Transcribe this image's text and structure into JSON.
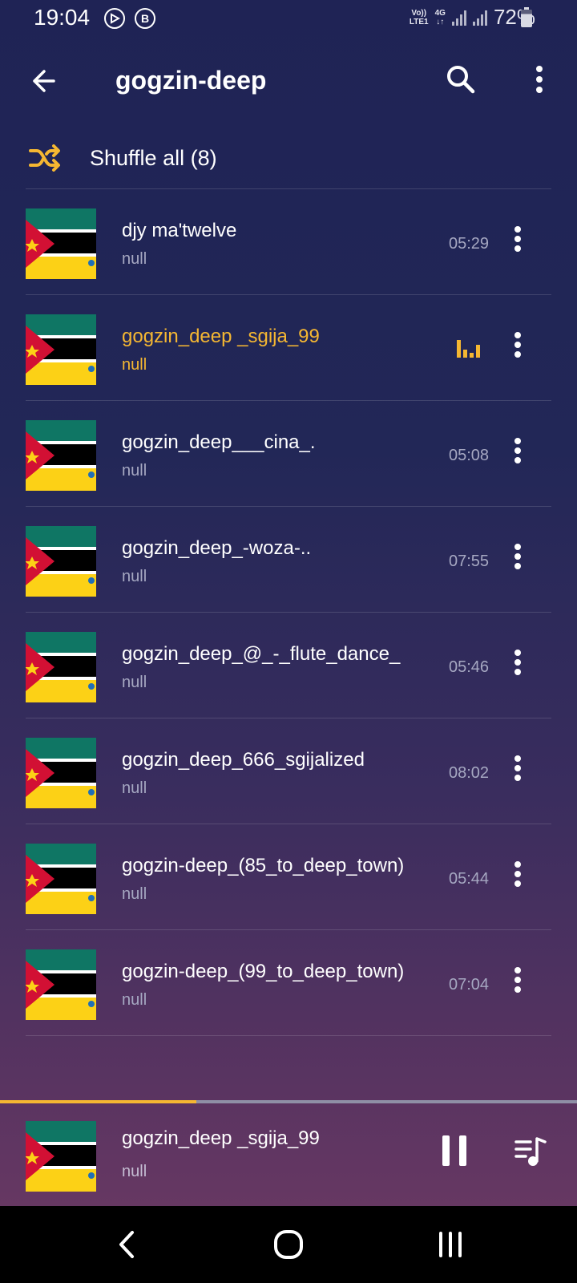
{
  "status_bar": {
    "time": "19:04",
    "notif_icons": [
      "media-play-icon",
      "b-badge-icon"
    ],
    "network_top": "Vo))",
    "network_bottom": "LTE1",
    "network_gen": "4G",
    "battery_text": "72%"
  },
  "toolbar": {
    "title": "gogzin-deep",
    "back_icon": "arrow-left-icon",
    "search_icon": "search-icon",
    "more_icon": "more-vertical-icon"
  },
  "shuffle": {
    "label": "Shuffle all (8)",
    "icon": "shuffle-icon"
  },
  "songs": [
    {
      "title": "djy ma'twelve",
      "artist": "null",
      "duration": "05:29"
    },
    {
      "title": "gogzin_deep _sgija_99",
      "artist": "null",
      "duration": "",
      "playing": true
    },
    {
      "title": "gogzin_deep___cina_.",
      "artist": "null",
      "duration": "05:08"
    },
    {
      "title": "gogzin_deep_-woza-..",
      "artist": "null",
      "duration": "07:55"
    },
    {
      "title": "gogzin_deep_@_-_flute_dance_",
      "artist": "null",
      "duration": "05:46"
    },
    {
      "title": "gogzin_deep_666_sgijalized",
      "artist": "null",
      "duration": "08:02"
    },
    {
      "title": "gogzin-deep_(85_to_deep_town)",
      "artist": "null",
      "duration": "05:44"
    },
    {
      "title": "gogzin-deep_(99_to_deep_town)",
      "artist": "null",
      "duration": "07:04"
    }
  ],
  "now_playing": {
    "title": "gogzin_deep _sgija_99",
    "artist": "null",
    "progress": 0.34
  },
  "colors": {
    "accent": "#f5b732",
    "muted_text": "#a6a8c2",
    "bg_top": "#1f2355",
    "bg_bottom": "#6e3a63"
  }
}
